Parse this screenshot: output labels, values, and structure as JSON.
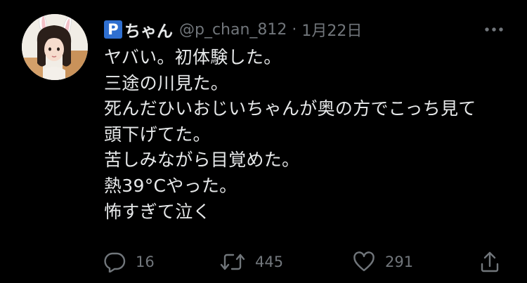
{
  "user": {
    "badge_letter": "P",
    "name_suffix": "ちゃん",
    "handle": "@p_chan_812",
    "separator": "·",
    "date": "1月22日"
  },
  "tweet": {
    "lines": [
      "ヤバい。初体験した。",
      "三途の川見た。",
      "死んだひいおじいちゃんが奥の方でこっち見て",
      "頭下げてた。",
      "苦しみながら目覚めた。",
      "熱39°Cやった。",
      "怖すぎて泣く"
    ]
  },
  "actions": {
    "reply_count": "16",
    "retweet_count": "445",
    "like_count": "291"
  },
  "icons": {
    "more": "more-icon",
    "reply": "reply-icon",
    "retweet": "retweet-icon",
    "like": "heart-icon",
    "share": "share-icon"
  },
  "colors": {
    "background": "#000000",
    "text": "#e7e9ea",
    "secondary": "#71767b",
    "badge": "#2f6fd0"
  }
}
